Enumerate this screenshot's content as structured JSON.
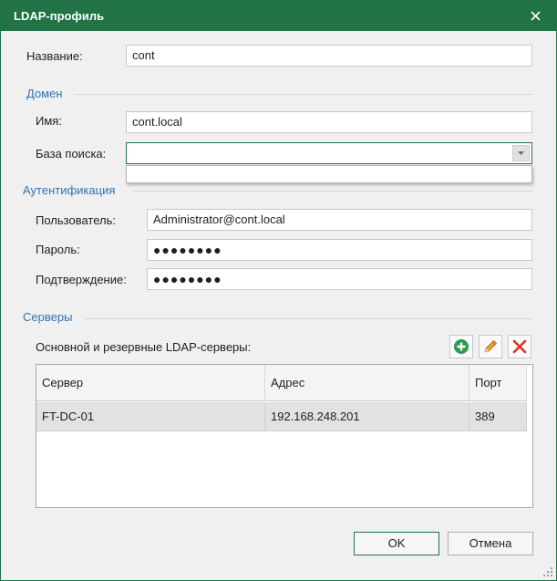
{
  "window": {
    "title": "LDAP-профиль"
  },
  "name_label": "Название:",
  "name_value": "cont",
  "domain": {
    "section_title": "Домен",
    "name_label": "Имя:",
    "name_value": "cont.local",
    "search_base_label": "База поиска:",
    "search_base_value": ""
  },
  "auth": {
    "section_title": "Аутентификация",
    "user_label": "Пользователь:",
    "user_value": "Administrator@cont.local",
    "password_label": "Пароль:",
    "password_value": "●●●●●●●●",
    "confirm_label": "Подтверждение:",
    "confirm_value": "●●●●●●●●"
  },
  "servers": {
    "section_title": "Серверы",
    "list_label": "Основной и резервные LDAP-серверы:",
    "columns": [
      "Сервер",
      "Адрес",
      "Порт"
    ],
    "rows": [
      {
        "server": "FT-DC-01",
        "address": "192.168.248.201",
        "port": "389"
      }
    ]
  },
  "buttons": {
    "ok": "OK",
    "cancel": "Отмена"
  },
  "colors": {
    "accent": "#217346",
    "section": "#2e75b6",
    "delete": "#d9342b",
    "add": "#2e9a4f",
    "edit": "#f0a030"
  }
}
